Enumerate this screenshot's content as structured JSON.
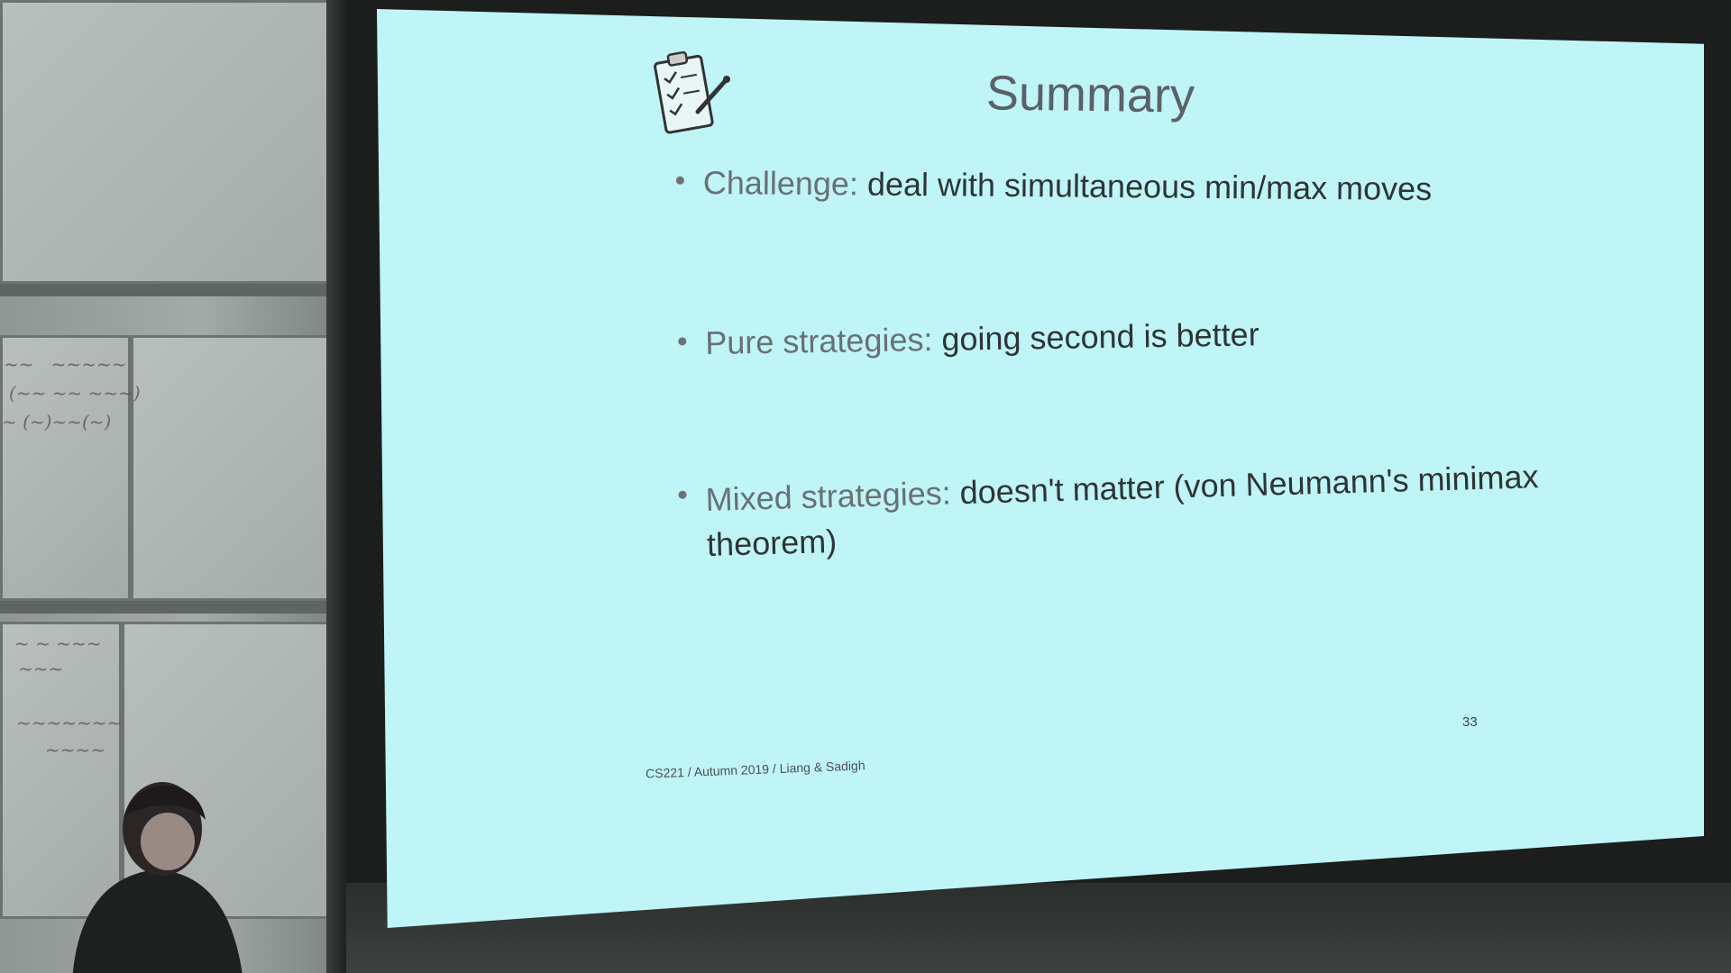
{
  "slide": {
    "title": "Summary",
    "bullets": [
      {
        "term": "Challenge:",
        "text": " deal with simultaneous min/max moves"
      },
      {
        "term": "Pure strategies:",
        "text": " going second is better"
      },
      {
        "term": "Mixed strategies:",
        "text": " doesn't matter (von Neumann's minimax",
        "continuation": "theorem)"
      }
    ],
    "page_number": "33",
    "footer": "CS221 / Autumn 2019 / Liang & Sadigh",
    "icon": "clipboard-checklist-icon"
  },
  "colors": {
    "slide_background": "#bff5f7",
    "title": "#5b6168",
    "body_text": "#2f3436",
    "term_text": "#6a7075"
  }
}
